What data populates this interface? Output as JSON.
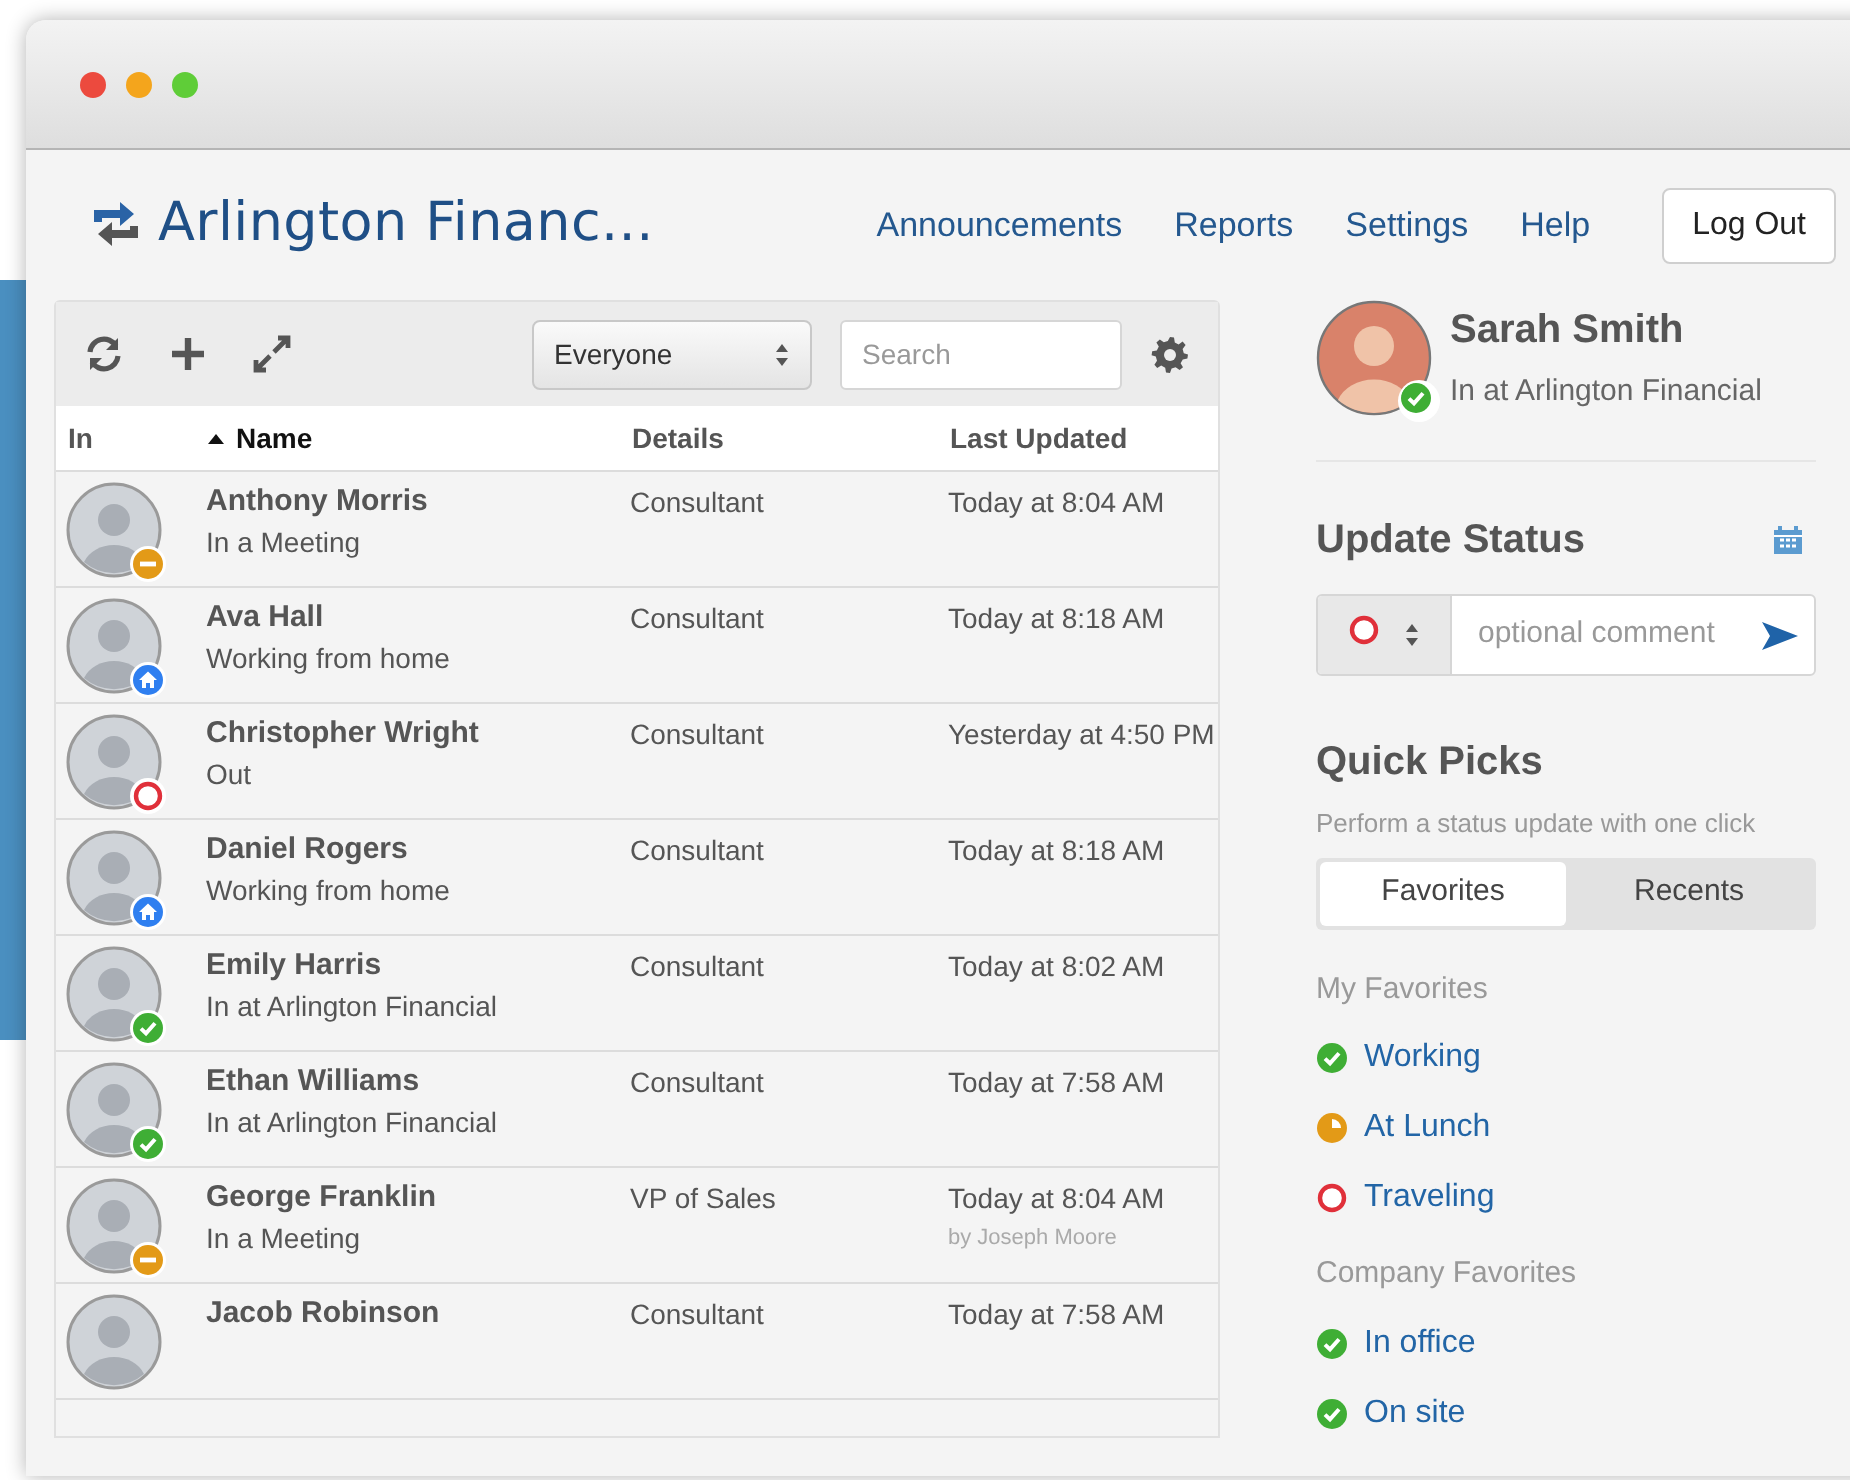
{
  "header": {
    "brand": "Arlington Financ...",
    "nav": [
      "Announcements",
      "Reports",
      "Settings",
      "Help"
    ],
    "logout": "Log Out"
  },
  "toolbar": {
    "filter": "Everyone",
    "search": {
      "placeholder": "Search"
    }
  },
  "table": {
    "columns": [
      {
        "label": "In",
        "sorted": false
      },
      {
        "label": "Name",
        "sorted": true
      },
      {
        "label": "Details",
        "sorted": false
      },
      {
        "label": "Last Updated",
        "sorted": false
      }
    ],
    "rows": [
      {
        "name": "Anthony Morris",
        "status_text": "In a Meeting",
        "kind": "meeting",
        "details": "Consultant",
        "updated": "Today at 8:04 AM"
      },
      {
        "name": "Ava Hall",
        "status_text": "Working from home",
        "kind": "home",
        "details": "Consultant",
        "updated": "Today at 8:18 AM"
      },
      {
        "name": "Christopher Wright",
        "status_text": "Out",
        "kind": "out",
        "details": "Consultant",
        "updated": "Yesterday at 4:50 PM"
      },
      {
        "name": "Daniel Rogers",
        "status_text": "Working from home",
        "kind": "home",
        "details": "Consultant",
        "updated": "Today at 8:18 AM"
      },
      {
        "name": "Emily Harris",
        "status_text": "In at Arlington Financial",
        "kind": "in",
        "details": "Consultant",
        "updated": "Today at 8:02 AM"
      },
      {
        "name": "Ethan Williams",
        "status_text": "In at Arlington Financial",
        "kind": "in",
        "details": "Consultant",
        "updated": "Today at 7:58 AM"
      },
      {
        "name": "George Franklin",
        "status_text": "In a Meeting",
        "kind": "meeting",
        "details": "VP of Sales",
        "updated": "Today at 8:04 AM",
        "updated_by": "by Joseph Moore"
      },
      {
        "name": "Jacob Robinson",
        "kind": "none",
        "details": "Consultant",
        "updated": "Today at 7:58 AM"
      }
    ]
  },
  "profile": {
    "name": "Sarah Smith",
    "status_text": "In at Arlington Financial",
    "kind": "in"
  },
  "update_status": {
    "title": "Update Status",
    "kind": "out",
    "comment": {
      "placeholder": "optional comment"
    }
  },
  "quick_picks": {
    "title": "Quick Picks",
    "subtitle": "Perform a status update with one click",
    "tabs": [
      {
        "label": "Favorites",
        "selected": true
      },
      {
        "label": "Recents",
        "selected": false
      }
    ],
    "groups": [
      {
        "title": "My Favorites",
        "items": [
          {
            "label": "Working",
            "kind": "in"
          },
          {
            "label": "At Lunch",
            "kind": "lunch"
          },
          {
            "label": "Traveling",
            "kind": "out"
          }
        ]
      },
      {
        "title": "Company Favorites",
        "items": [
          {
            "label": "In office",
            "kind": "in"
          },
          {
            "label": "On site",
            "kind": "in"
          }
        ]
      }
    ]
  }
}
